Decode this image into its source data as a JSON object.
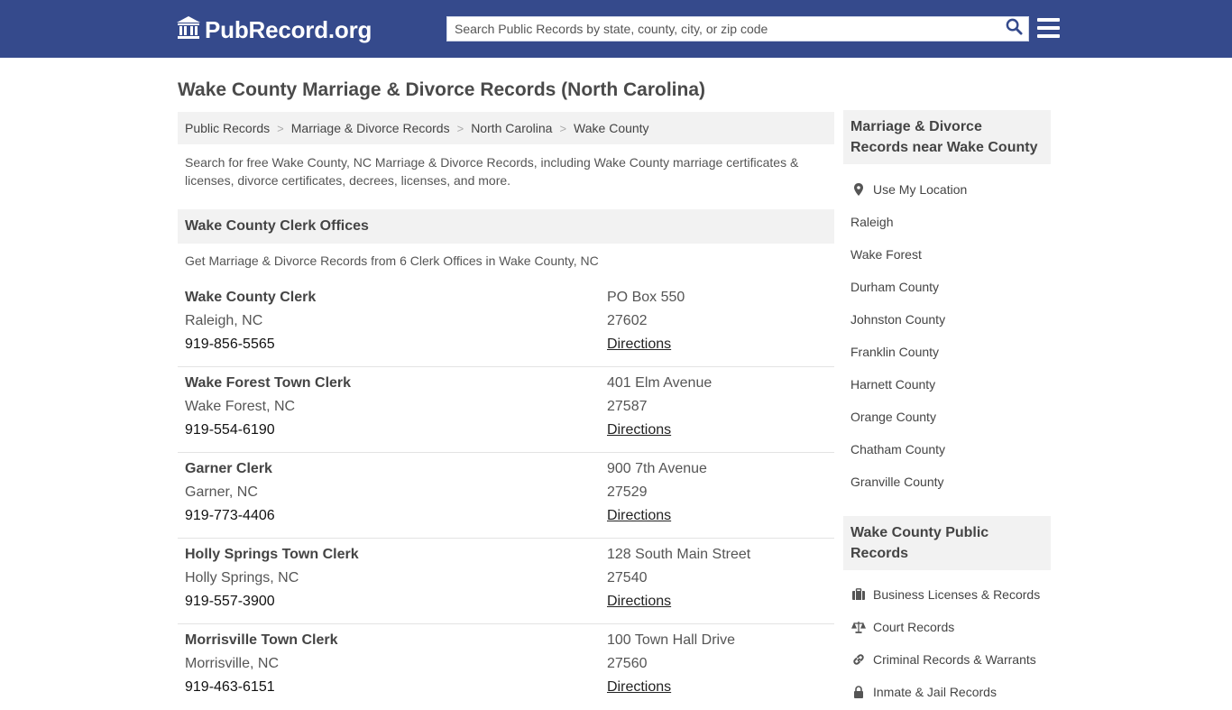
{
  "header": {
    "logo_text": "PubRecord.org",
    "search_placeholder": "Search Public Records by state, county, city, or zip code"
  },
  "page": {
    "title": "Wake County Marriage & Divorce Records (North Carolina)",
    "intro": "Search for free Wake County, NC Marriage & Divorce Records, including Wake County marriage certificates & licenses, divorce certificates, decrees, licenses, and more."
  },
  "breadcrumb": [
    "Public Records",
    "Marriage & Divorce Records",
    "North Carolina",
    "Wake County"
  ],
  "clerk_section": {
    "title": "Wake County Clerk Offices",
    "subtitle": "Get Marriage & Divorce Records from 6 Clerk Offices in Wake County, NC",
    "directions_label": "Directions",
    "offices": [
      {
        "name": "Wake County Clerk",
        "city": "Raleigh, NC",
        "phone": "919-856-5565",
        "address": "PO Box 550",
        "zip": "27602"
      },
      {
        "name": "Wake Forest Town Clerk",
        "city": "Wake Forest, NC",
        "phone": "919-554-6190",
        "address": "401 Elm Avenue",
        "zip": "27587"
      },
      {
        "name": "Garner Clerk",
        "city": "Garner, NC",
        "phone": "919-773-4406",
        "address": "900 7th Avenue",
        "zip": "27529"
      },
      {
        "name": "Holly Springs Town Clerk",
        "city": "Holly Springs, NC",
        "phone": "919-557-3900",
        "address": "128 South Main Street",
        "zip": "27540"
      },
      {
        "name": "Morrisville Town Clerk",
        "city": "Morrisville, NC",
        "phone": "919-463-6151",
        "address": "100 Town Hall Drive",
        "zip": "27560"
      }
    ]
  },
  "sidebar": {
    "nearby_title": "Marriage & Divorce Records near Wake County",
    "use_location": "Use My Location",
    "nearby": [
      "Raleigh",
      "Wake Forest",
      "Durham County",
      "Johnston County",
      "Franklin County",
      "Harnett County",
      "Orange County",
      "Chatham County",
      "Granville County"
    ],
    "public_title": "Wake County Public Records",
    "public_records": [
      {
        "label": "Business Licenses & Records",
        "icon": "briefcase-icon"
      },
      {
        "label": "Court Records",
        "icon": "scales-icon"
      },
      {
        "label": "Criminal Records & Warrants",
        "icon": "link-icon"
      },
      {
        "label": "Inmate & Jail Records",
        "icon": "lock-icon"
      }
    ]
  },
  "colors": {
    "header_bg": "#354a8c",
    "panel_bg": "#f2f2f2",
    "search_icon": "#354a8c"
  }
}
